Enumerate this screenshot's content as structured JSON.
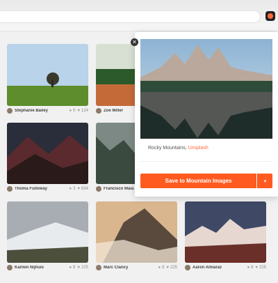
{
  "extension": {
    "icon": "unsplash-extension-icon"
  },
  "grid": [
    {
      "user": "Stephanie Bailey",
      "comments": "0",
      "likes": "124"
    },
    {
      "user": "Zoe Miller",
      "comments": "",
      "likes": ""
    },
    {
      "user": "Thoma Fulloway",
      "comments": "3",
      "likes": "834"
    },
    {
      "user": "Francisco Maia",
      "comments": "",
      "likes": ""
    },
    {
      "user": "Karlien Nijhuis",
      "comments": "8",
      "likes": "225"
    },
    {
      "user": "Marc Clancy",
      "comments": "8",
      "likes": "225"
    },
    {
      "user": "Aaron Almaraz",
      "comments": "8",
      "likes": "225"
    }
  ],
  "popup": {
    "caption_text": "Rocky Mountains, ",
    "caption_link": "Unsplash",
    "save_label": "Save to Mountain Images",
    "dropdown_icon": "chevron-down-icon",
    "close_icon": "close-icon"
  },
  "colors": {
    "accent": "#ff5a1f",
    "link": "#ff6a3c"
  }
}
